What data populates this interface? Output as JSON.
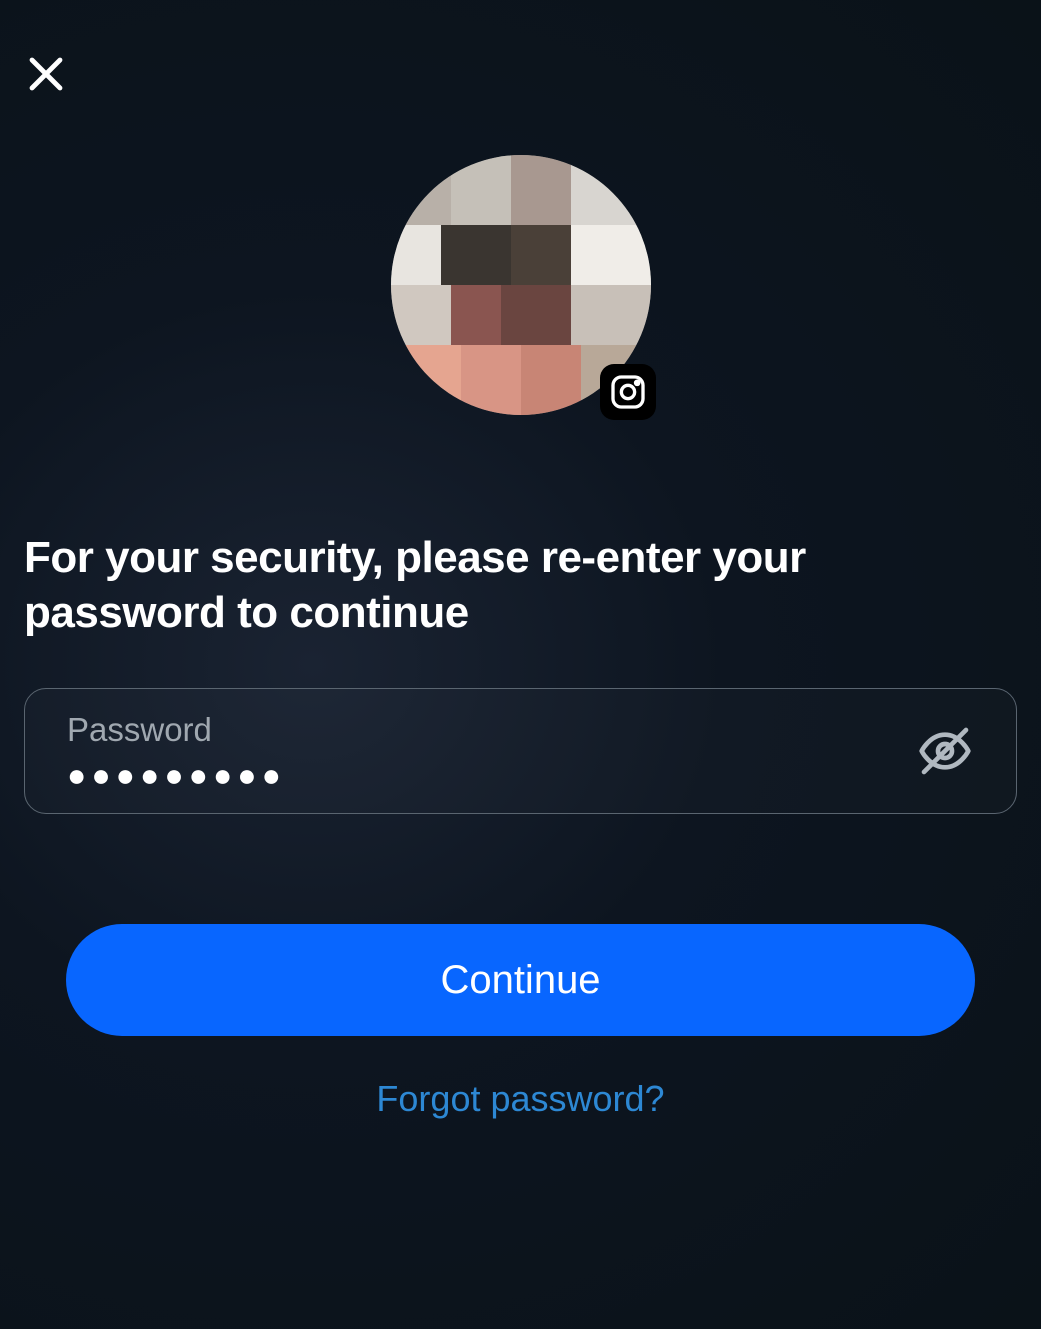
{
  "heading": "For your security, please re-enter your password to continue",
  "password_field": {
    "label": "Password",
    "masked_value": "●●●●●●●●●"
  },
  "buttons": {
    "continue": "Continue",
    "forgot_password": "Forgot password?"
  },
  "icons": {
    "close": "close-icon",
    "eye_hidden": "eye-slash-icon",
    "instagram": "instagram-icon"
  }
}
